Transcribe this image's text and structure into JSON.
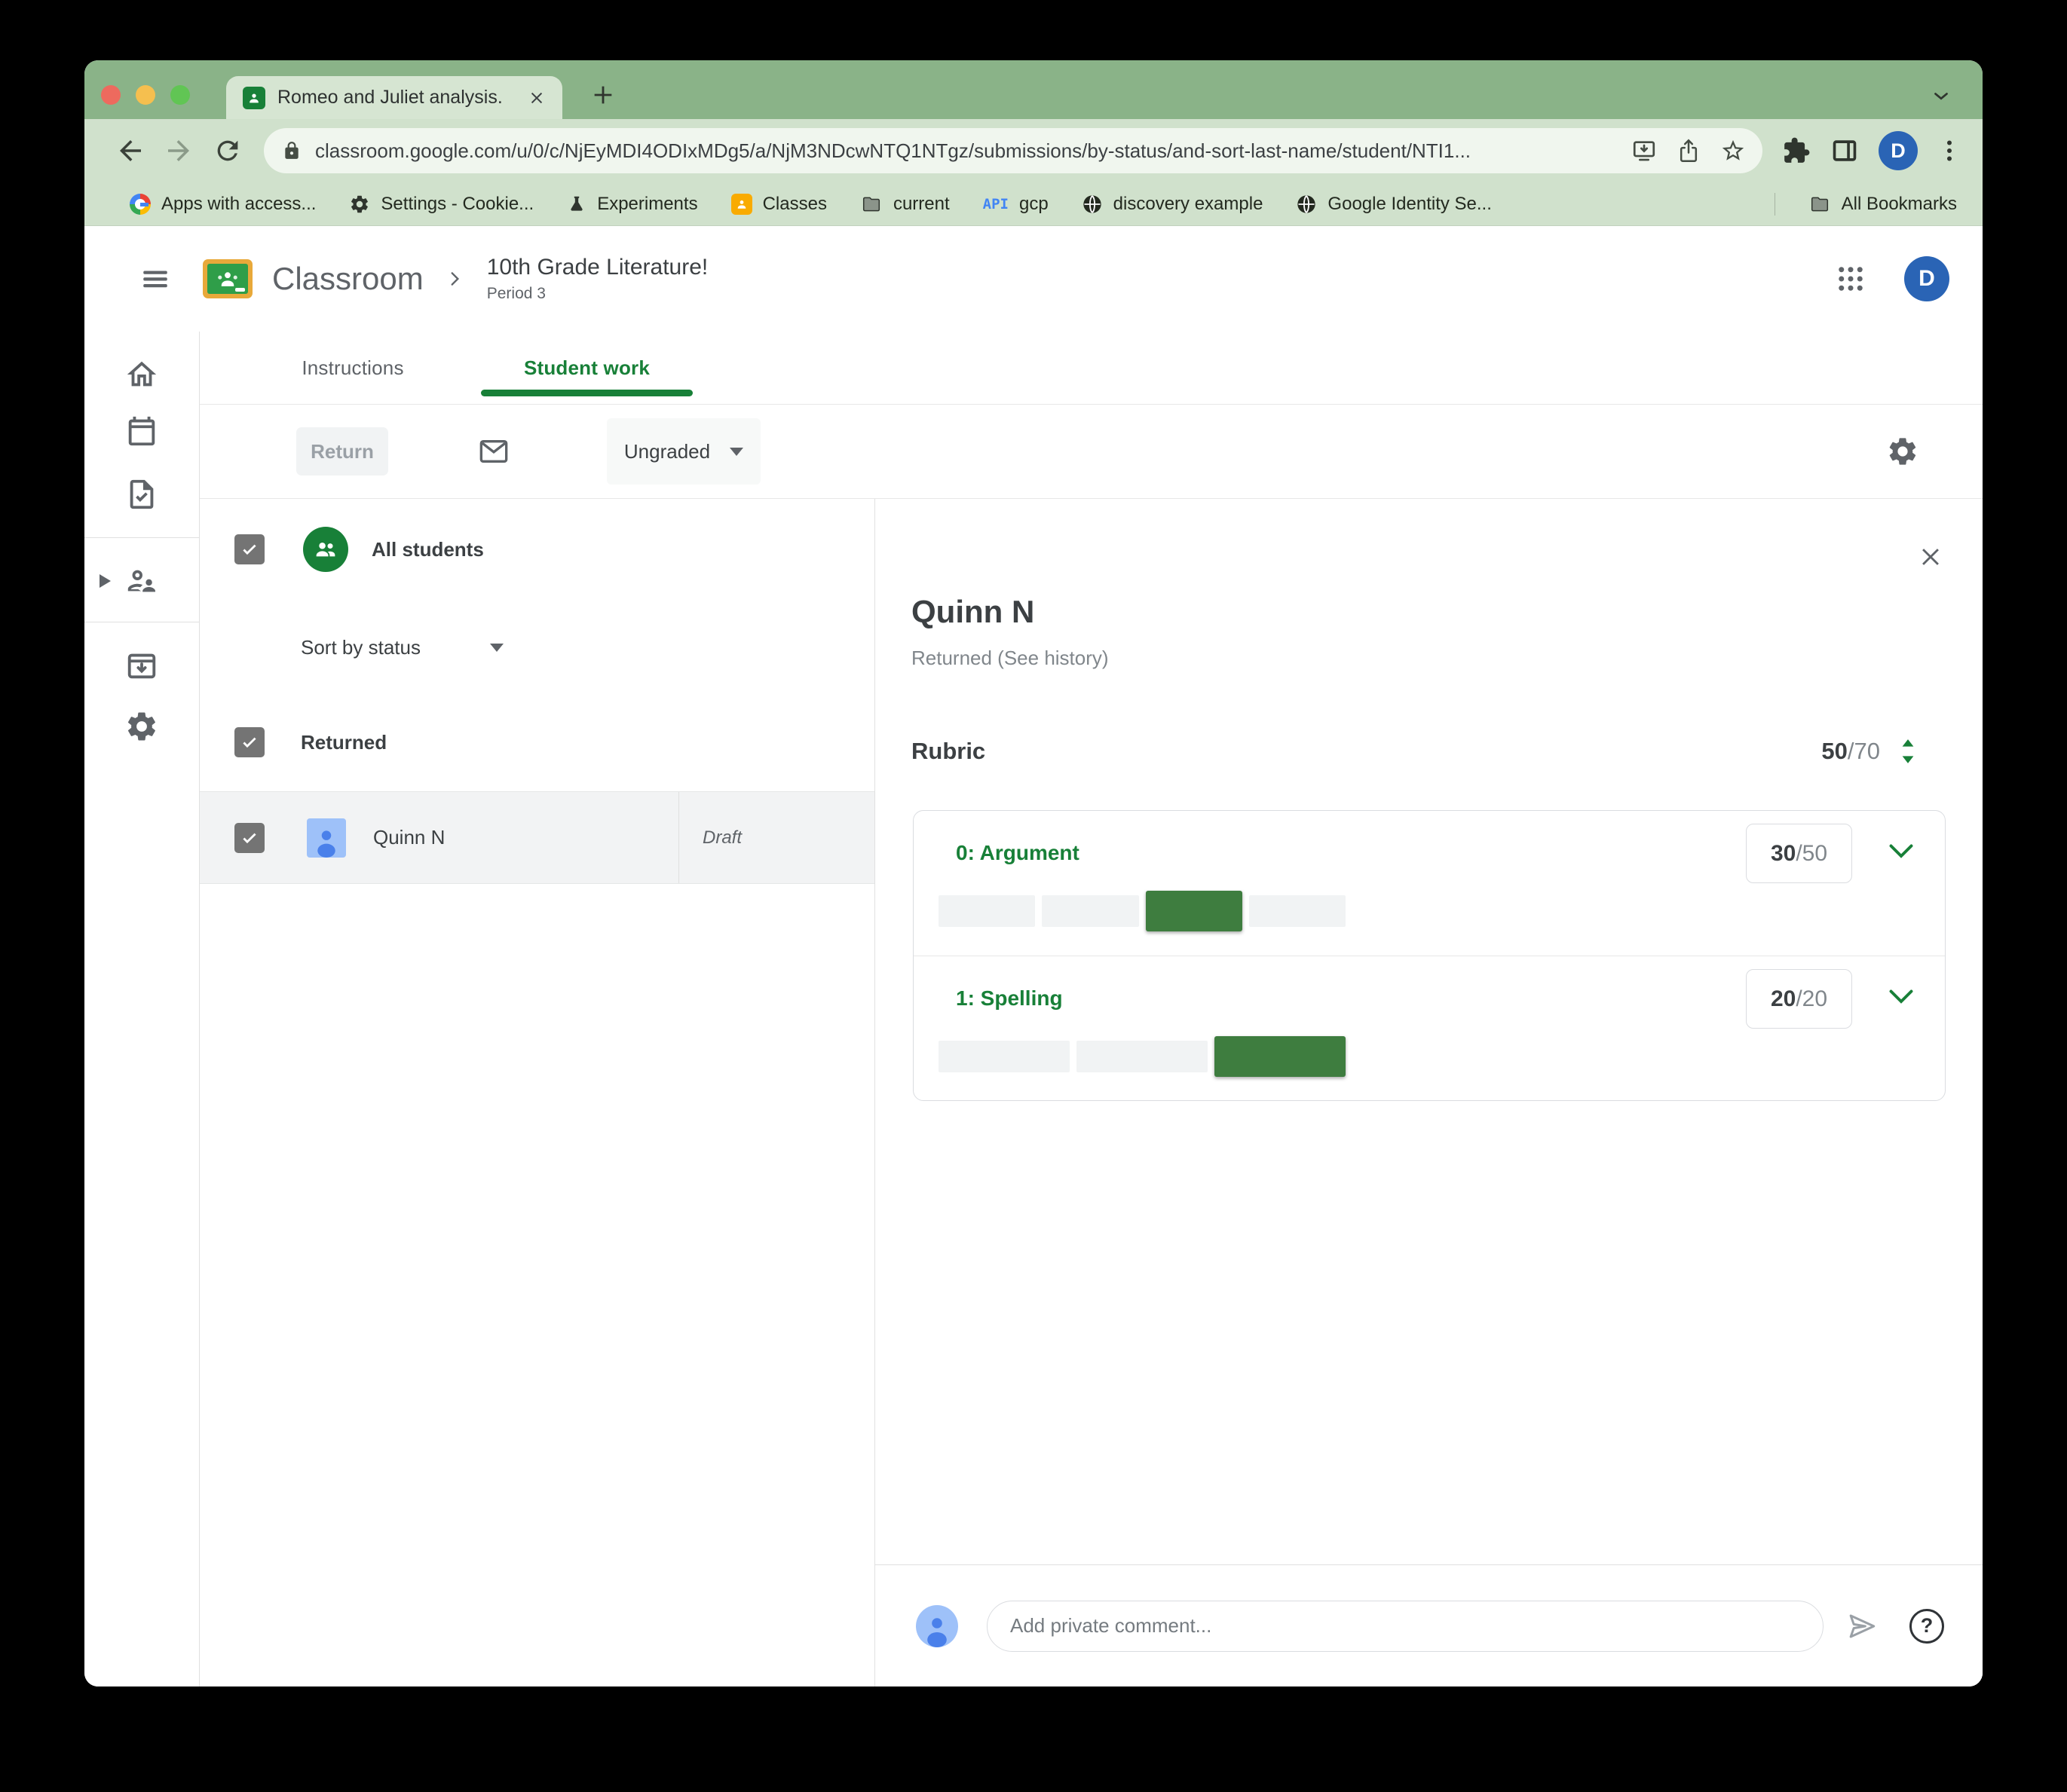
{
  "colors": {
    "classroom_green": "#188038",
    "rubric_fill": "#3e7d3f",
    "tab_strip": "#8ab388",
    "chrome_bg": "#d0e1cc",
    "tab_bg": "#d6e5d2",
    "url_pill": "#f0f6ee",
    "traffic_red": "#ed6a5e",
    "traffic_yellow": "#f5bf4f",
    "traffic_green": "#61c554",
    "profile_blue": "#2a64b5",
    "student_avatar_bg": "#9ec1f9",
    "student_avatar_fg": "#4a80ea"
  },
  "browser": {
    "tab_title": "Romeo and Juliet analysis.",
    "new_tab_glyph": "+",
    "url": "classroom.google.com/u/0/c/NjEyMDI4ODIxMDg5/a/NjM3NDcwNTQ1NTgz/submissions/by-status/and-sort-last-name/student/NTI1...",
    "profile_initial": "D",
    "bookmarks": [
      {
        "label": "Apps with access...",
        "icon": "google-g-icon"
      },
      {
        "label": "Settings - Cookie...",
        "icon": "gear-icon"
      },
      {
        "label": "Experiments",
        "icon": "flask-icon"
      },
      {
        "label": "Classes",
        "icon": "classroom-icon"
      },
      {
        "label": "current",
        "icon": "folder-icon"
      },
      {
        "label": "gcp",
        "icon": "api-text-icon",
        "icon_text": "API"
      },
      {
        "label": "discovery example",
        "icon": "globe-icon"
      },
      {
        "label": "Google Identity Se...",
        "icon": "globe-icon"
      }
    ],
    "all_bookmarks_label": "All Bookmarks"
  },
  "header": {
    "app_name": "Classroom",
    "course_title": "10th Grade Literature!",
    "course_period": "Period 3",
    "profile_initial": "D"
  },
  "tabs": {
    "instructions": "Instructions",
    "student_work": "Student work"
  },
  "toolbar": {
    "return_label": "Return",
    "grade_filter": "Ungraded"
  },
  "student_list": {
    "all_students_label": "All students",
    "sort_label": "Sort by status",
    "group_label": "Returned",
    "students": [
      {
        "name": "Quinn N",
        "status": "Draft"
      }
    ]
  },
  "detail": {
    "student_name": "Quinn N",
    "status_line": "Returned (See history)",
    "rubric": {
      "label": "Rubric",
      "score": "50",
      "total": "/70",
      "criteria": [
        {
          "name": "0: Argument",
          "score": "30",
          "total": "/50",
          "segments": [
            false,
            false,
            true,
            false
          ]
        },
        {
          "name": "1: Spelling",
          "score": "20",
          "total": "/20",
          "segments": [
            false,
            false,
            true
          ]
        }
      ]
    },
    "comment_placeholder": "Add private comment...",
    "help_glyph": "?"
  }
}
